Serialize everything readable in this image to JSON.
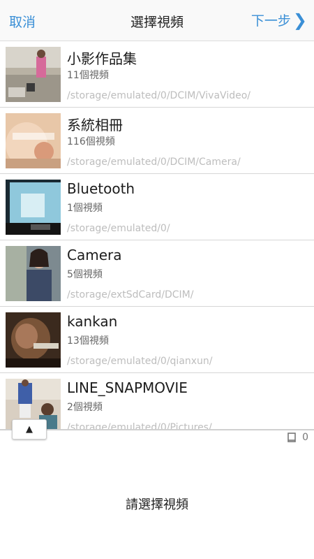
{
  "header": {
    "cancel_label": "取消",
    "title": "選擇視頻",
    "next_label": "下一步",
    "next_icon": "❯"
  },
  "albums": [
    {
      "name": "小影作品集",
      "count": "11個視頻",
      "path": "/storage/emulated/0/DCIM/VivaVideo/"
    },
    {
      "name": "系統相冊",
      "count": "116個視頻",
      "path": "/storage/emulated/0/DCIM/Camera/"
    },
    {
      "name": "Bluetooth",
      "count": "1個視頻",
      "path": "/storage/emulated/0/"
    },
    {
      "name": "Camera",
      "count": "5個視頻",
      "path": "/storage/extSdCard/DCIM/"
    },
    {
      "name": "kankan",
      "count": "13個視頻",
      "path": "/storage/emulated/0/qianxun/"
    },
    {
      "name": "LINE_SNAPMOVIE",
      "count": "2個視頻",
      "path": "/storage/emulated/0/Pictures/"
    }
  ],
  "bottom": {
    "up_icon": "▲",
    "selected_count": "0",
    "prompt": "請選擇視頻"
  },
  "colors": {
    "accent": "#3a8fd6",
    "path_text": "#bdbdbd"
  }
}
